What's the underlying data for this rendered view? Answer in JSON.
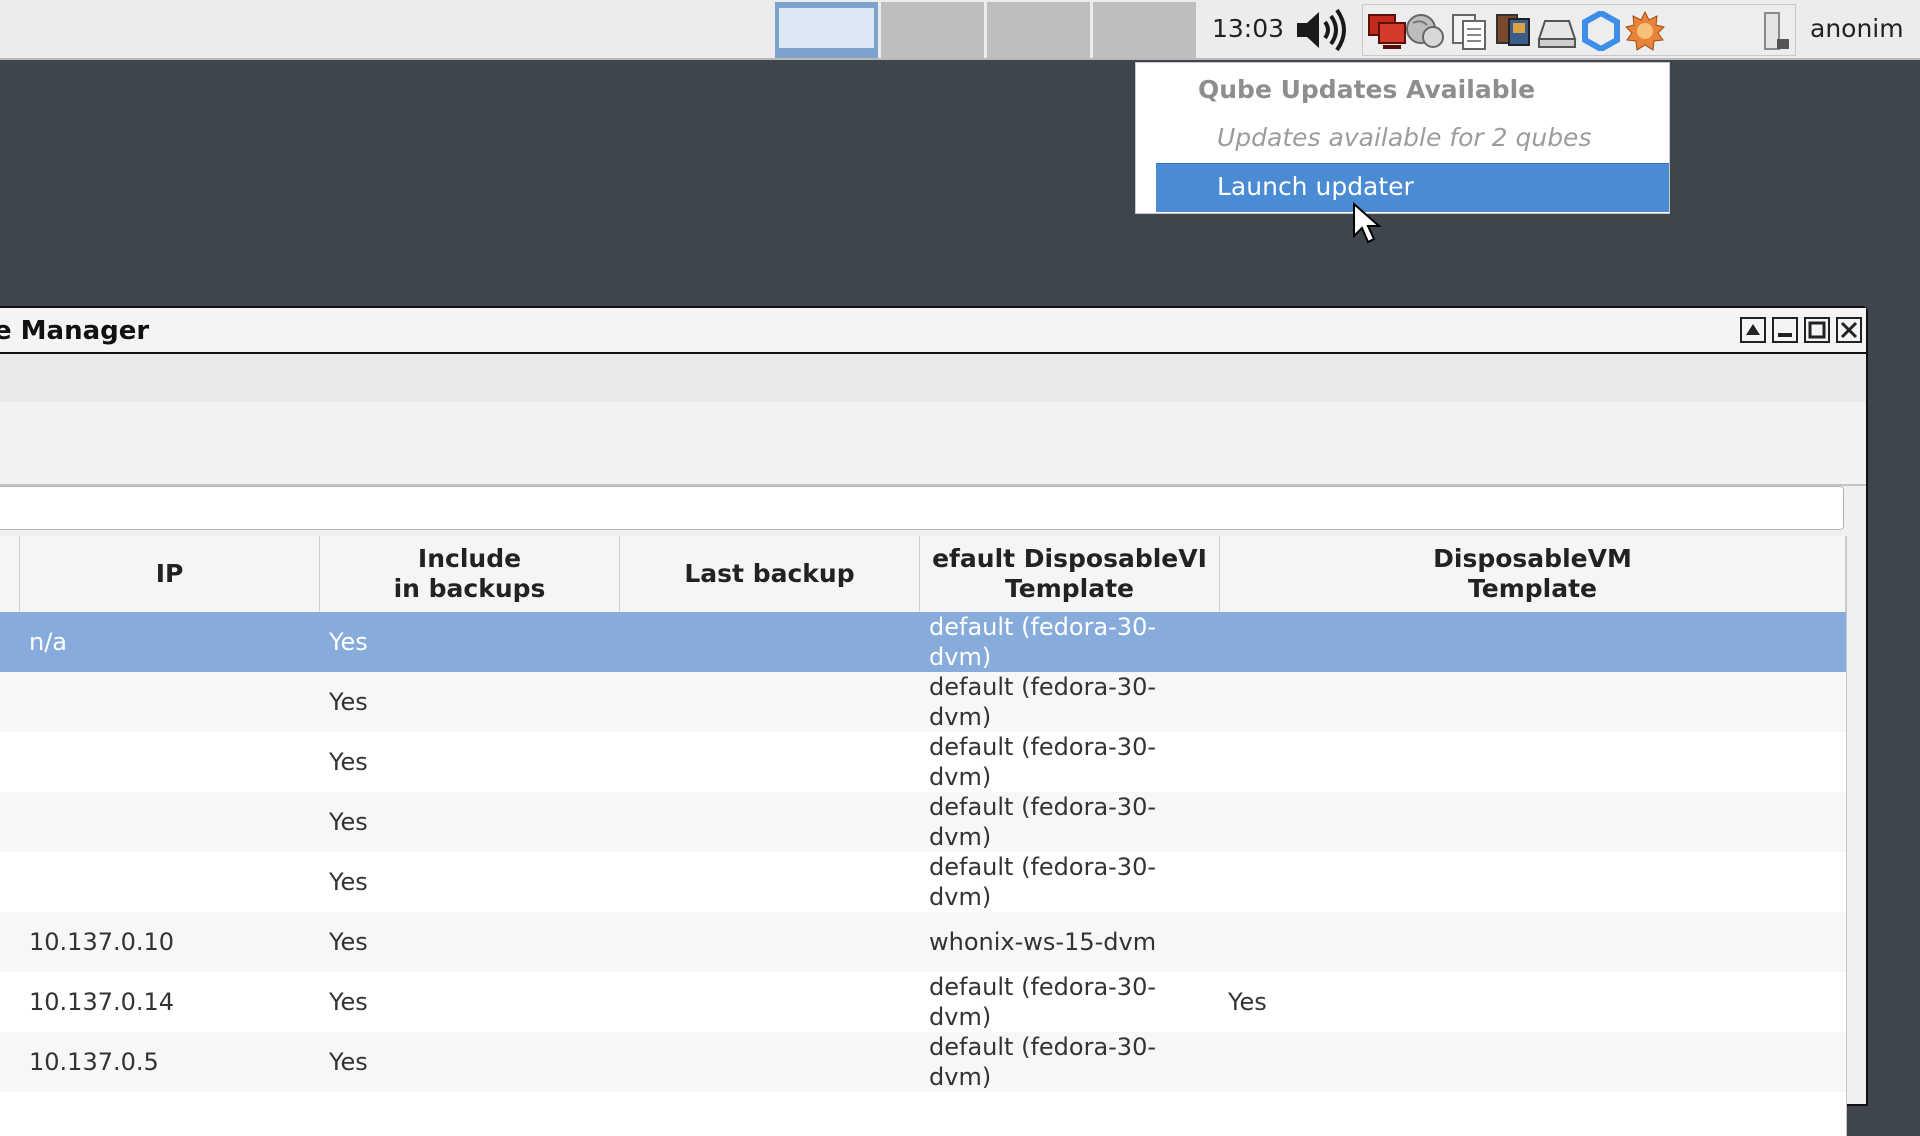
{
  "panel": {
    "clock": "13:03",
    "user": "anonim",
    "workspaces": [
      "1",
      "2",
      "3",
      "4"
    ],
    "active_workspace_index": 0,
    "tray_icons": [
      "qubes-domains-icon",
      "network-manager-icon",
      "clipboard-icon",
      "devices-icon",
      "disk-icon",
      "qubes-logo-icon",
      "updates-sun-icon",
      "battery-icon"
    ]
  },
  "notification": {
    "title": "Qube Updates Available",
    "subtitle": "Updates available for 2 qubes",
    "action": "Launch updater"
  },
  "window": {
    "title": "e Manager"
  },
  "table": {
    "headers": {
      "ip": "IP",
      "backups": "Include\nin backups",
      "last_backup": "Last backup",
      "default_dvm": "efault DisposableVI\nTemplate",
      "dvm_template": "DisposableVM\nTemplate"
    },
    "rows": [
      {
        "ip": "n/a",
        "backups": "Yes",
        "last_backup": "",
        "default_dvm": "default (fedora-30-dvm)",
        "dvm_template": "",
        "selected": true
      },
      {
        "ip": "",
        "backups": "Yes",
        "last_backup": "",
        "default_dvm": "default (fedora-30-dvm)",
        "dvm_template": ""
      },
      {
        "ip": "",
        "backups": "Yes",
        "last_backup": "",
        "default_dvm": "default (fedora-30-dvm)",
        "dvm_template": ""
      },
      {
        "ip": "",
        "backups": "Yes",
        "last_backup": "",
        "default_dvm": "default (fedora-30-dvm)",
        "dvm_template": ""
      },
      {
        "ip": "",
        "backups": "Yes",
        "last_backup": "",
        "default_dvm": "default (fedora-30-dvm)",
        "dvm_template": ""
      },
      {
        "ip": "10.137.0.10",
        "backups": "Yes",
        "last_backup": "",
        "default_dvm": "whonix-ws-15-dvm",
        "dvm_template": ""
      },
      {
        "ip": "10.137.0.14",
        "backups": "Yes",
        "last_backup": "",
        "default_dvm": "default (fedora-30-dvm)",
        "dvm_template": "Yes"
      },
      {
        "ip": "10.137.0.5",
        "backups": "Yes",
        "last_backup": "",
        "default_dvm": "default (fedora-30-dvm)",
        "dvm_template": ""
      }
    ]
  }
}
